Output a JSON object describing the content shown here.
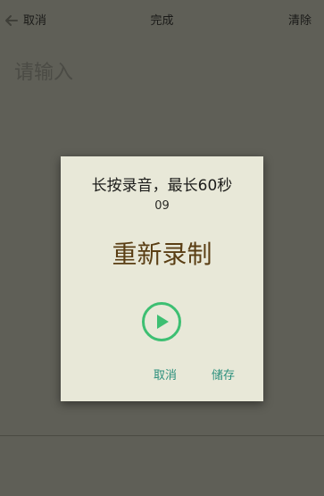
{
  "topbar": {
    "back_icon": "arrow-left-icon",
    "cancel_label": "取消",
    "title": "完成",
    "clear_label": "清除"
  },
  "editor": {
    "placeholder": "请输入"
  },
  "dialog": {
    "title": "长按录音，最长60秒",
    "timer": "09",
    "rerecord_label": "重新录制",
    "play_icon": "play-icon",
    "cancel_label": "取消",
    "save_label": "储存"
  },
  "colors": {
    "accent": "#2a8f7c",
    "play_circle": "#3dbf72",
    "rerecord_text": "#5a3e14",
    "dialog_bg": "#e8e8d8",
    "overlay_bg": "#5f5f57"
  }
}
